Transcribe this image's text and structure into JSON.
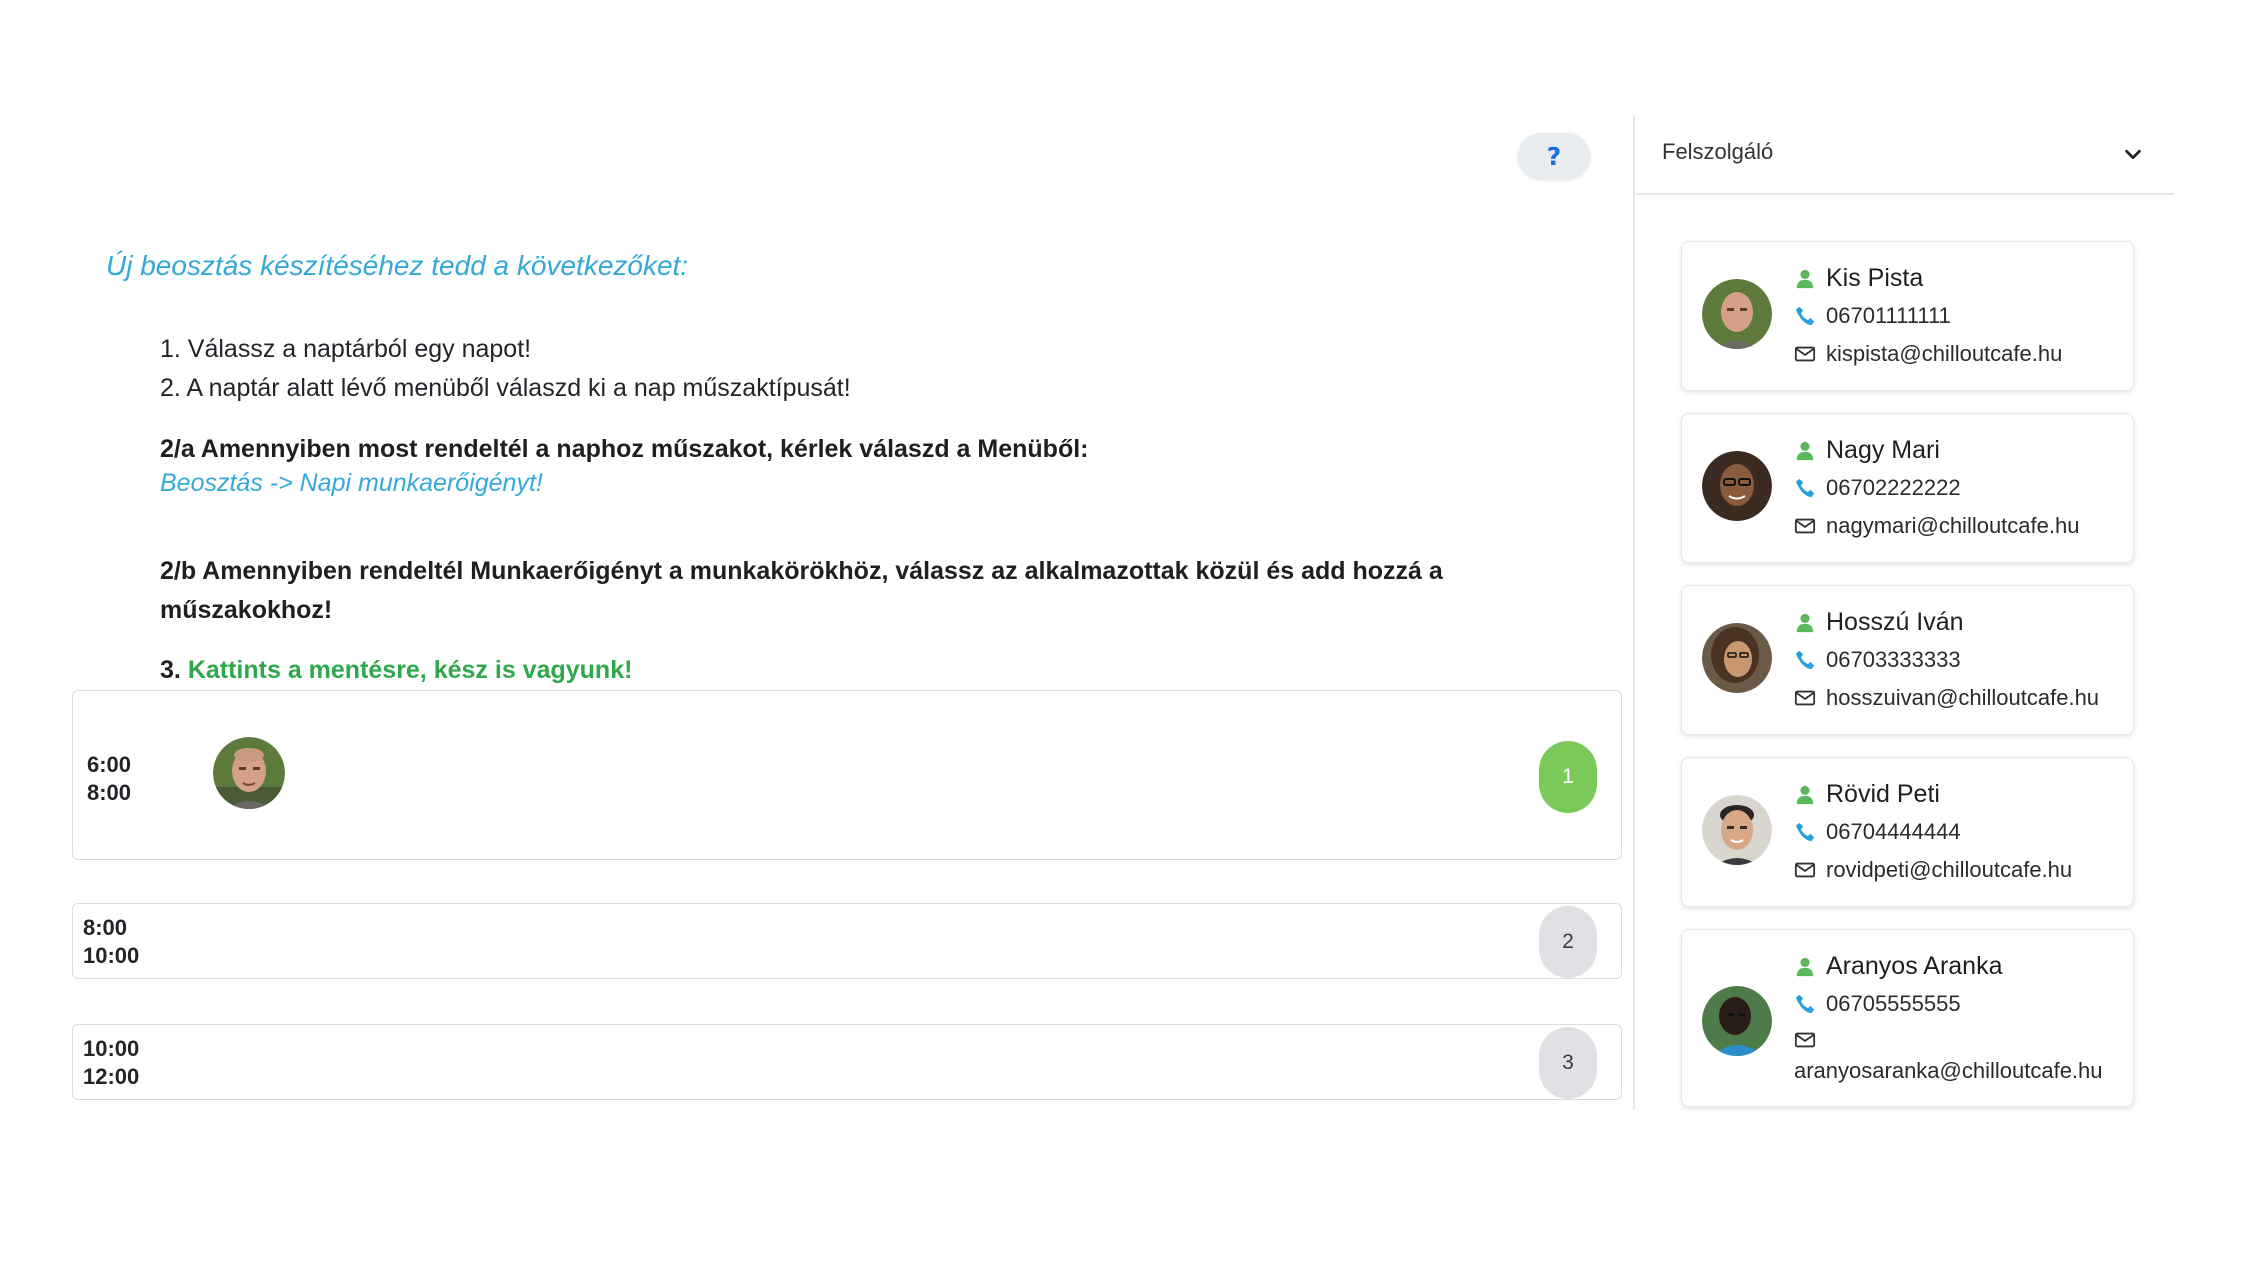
{
  "help": {
    "label": "?"
  },
  "intro": {
    "title": "Új beosztás készítéséhez tedd a következőket:",
    "step1": "1. Válassz a naptárból egy napot!",
    "step2": "2. A naptár alatt lévő menüből válaszd ki a nap műszaktípusát!",
    "step2a": "2/a Amennyiben most rendeltél a naphoz műszakot, kérlek válaszd a Menüből:",
    "step2a_link": "Beosztás -> Napi munkaerőigényt!",
    "step2b": "2/b Amennyiben rendeltél Munkaerőigényt a munkakörökhöz, válassz az alkalmazottak közül és add hozzá a műszakokhoz!",
    "step3_num": "3.",
    "step3": "Kattints a mentésre, kész is vagyunk!"
  },
  "shifts": [
    {
      "start": "6:00",
      "end": "8:00",
      "count": "1",
      "active": true
    },
    {
      "start": "8:00",
      "end": "10:00",
      "count": "2",
      "active": false
    },
    {
      "start": "10:00",
      "end": "12:00",
      "count": "3",
      "active": false
    }
  ],
  "sidebar": {
    "role_select": {
      "value": "Felszolgáló"
    },
    "employees": [
      {
        "name": "Kis Pista",
        "phone": "06701111111",
        "email": "kispista@chilloutcafe.hu"
      },
      {
        "name": "Nagy Mari",
        "phone": "06702222222",
        "email": "nagymari@chilloutcafe.hu"
      },
      {
        "name": "Hosszú Iván",
        "phone": "06703333333",
        "email": "hosszuivan@chilloutcafe.hu"
      },
      {
        "name": "Rövid Peti",
        "phone": "06704444444",
        "email": "rovidpeti@chilloutcafe.hu"
      },
      {
        "name": "Aranyos Aranka",
        "phone": "06705555555",
        "email": "aranyosaranka@chilloutcafe.hu"
      }
    ]
  },
  "colors": {
    "accent_blue": "#34a9d8",
    "success_green": "#2ea84a",
    "badge_active": "#7ac95a",
    "badge_idle": "#dfe1e5",
    "icon_person": "#5cb85c",
    "icon_phone": "#2aa0d8"
  },
  "icons": {
    "person": "person-icon",
    "phone": "phone-icon",
    "email": "envelope-icon",
    "dropdown": "chevron-down-icon"
  }
}
